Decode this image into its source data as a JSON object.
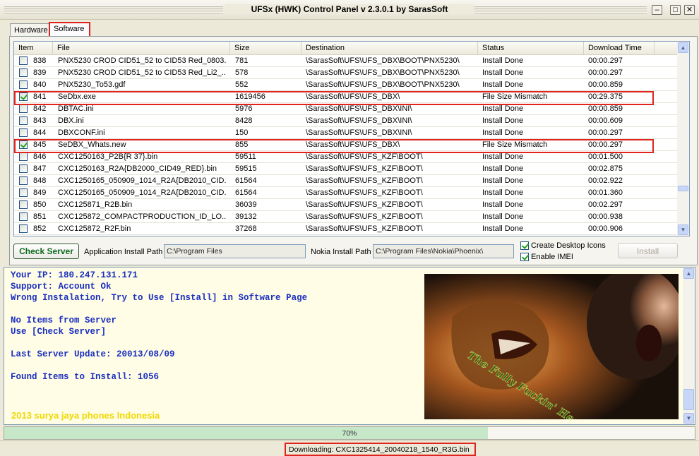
{
  "window": {
    "title": "UFSx (HWK) Control Panel v 2.3.0.1 by SarasSoft",
    "buttons": {
      "minimize": "–",
      "maximize": "□",
      "close": "✕"
    }
  },
  "tabs": [
    {
      "label": "Hardware",
      "active": false
    },
    {
      "label": "Software",
      "active": true
    }
  ],
  "table": {
    "columns": [
      "Item",
      "File",
      "Size",
      "Destination",
      "Status",
      "Download Time"
    ],
    "rows": [
      {
        "checked": false,
        "item": "838",
        "file": "PNX5230 CROD CID51_52 to CID53 Red_0803...",
        "size": "781",
        "dest": "\\SarasSoft\\UFS\\UFS_DBX\\BOOT\\PNX5230\\",
        "status": "Install Done",
        "time": "00:00.297",
        "highlight": false
      },
      {
        "checked": false,
        "item": "839",
        "file": "PNX5230 CROD CID51_52 to CID53 Red_Li2_...",
        "size": "578",
        "dest": "\\SarasSoft\\UFS\\UFS_DBX\\BOOT\\PNX5230\\",
        "status": "Install Done",
        "time": "00:00.297",
        "highlight": false
      },
      {
        "checked": false,
        "item": "840",
        "file": "PNX5230_To53.gdf",
        "size": "552",
        "dest": "\\SarasSoft\\UFS\\UFS_DBX\\BOOT\\PNX5230\\",
        "status": "Install Done",
        "time": "00:00.859",
        "highlight": false
      },
      {
        "checked": true,
        "item": "841",
        "file": "SeDbx.exe",
        "size": "1619456",
        "dest": "\\SarasSoft\\UFS\\UFS_DBX\\",
        "status": "File Size Mismatch",
        "time": "00:29.375",
        "highlight": true
      },
      {
        "checked": false,
        "item": "842",
        "file": "DBTAC.ini",
        "size": "5976",
        "dest": "\\SarasSoft\\UFS\\UFS_DBX\\INI\\",
        "status": "Install Done",
        "time": "00:00.859",
        "highlight": false
      },
      {
        "checked": false,
        "item": "843",
        "file": "DBX.ini",
        "size": "8428",
        "dest": "\\SarasSoft\\UFS\\UFS_DBX\\INI\\",
        "status": "Install Done",
        "time": "00:00.609",
        "highlight": false
      },
      {
        "checked": false,
        "item": "844",
        "file": "DBXCONF.ini",
        "size": "150",
        "dest": "\\SarasSoft\\UFS\\UFS_DBX\\INI\\",
        "status": "Install Done",
        "time": "00:00.297",
        "highlight": false
      },
      {
        "checked": true,
        "item": "845",
        "file": "SeDBX_Whats.new",
        "size": "855",
        "dest": "\\SarasSoft\\UFS\\UFS_DBX\\",
        "status": "File Size Mismatch",
        "time": "00:00.297",
        "highlight": true
      },
      {
        "checked": false,
        "item": "846",
        "file": "CXC1250163_P2B{R 37}.bin",
        "size": "59511",
        "dest": "\\SarasSoft\\UFS\\UFS_KZF\\BOOT\\",
        "status": "Install Done",
        "time": "00:01.500",
        "highlight": false
      },
      {
        "checked": false,
        "item": "847",
        "file": "CXC1250163_R2A{DB2000_CID49_RED}.bin",
        "size": "59515",
        "dest": "\\SarasSoft\\UFS\\UFS_KZF\\BOOT\\",
        "status": "Install Done",
        "time": "00:02.875",
        "highlight": false
      },
      {
        "checked": false,
        "item": "848",
        "file": "CXC1250165_050909_1014_R2A{DB2010_CID...",
        "size": "61564",
        "dest": "\\SarasSoft\\UFS\\UFS_KZF\\BOOT\\",
        "status": "Install Done",
        "time": "00:02.922",
        "highlight": false
      },
      {
        "checked": false,
        "item": "849",
        "file": "CXC1250165_050909_1014_R2A{DB2010_CID...",
        "size": "61564",
        "dest": "\\SarasSoft\\UFS\\UFS_KZF\\BOOT\\",
        "status": "Install Done",
        "time": "00:01.360",
        "highlight": false
      },
      {
        "checked": false,
        "item": "850",
        "file": "CXC125871_R2B.bin",
        "size": "36039",
        "dest": "\\SarasSoft\\UFS\\UFS_KZF\\BOOT\\",
        "status": "Install Done",
        "time": "00:02.297",
        "highlight": false
      },
      {
        "checked": false,
        "item": "851",
        "file": "CXC125872_COMPACTPRODUCTION_ID_LO...",
        "size": "39132",
        "dest": "\\SarasSoft\\UFS\\UFS_KZF\\BOOT\\",
        "status": "Install Done",
        "time": "00:00.938",
        "highlight": false
      },
      {
        "checked": false,
        "item": "852",
        "file": "CXC125872_R2F.bin",
        "size": "37268",
        "dest": "\\SarasSoft\\UFS\\UFS_KZF\\BOOT\\",
        "status": "Install Done",
        "time": "00:00.906",
        "highlight": false
      }
    ]
  },
  "controls": {
    "check_server": "Check Server",
    "app_path_label": "Application Install Path",
    "app_path_value": "C:\\Program Files",
    "nokia_path_label": "Nokia Install Path",
    "nokia_path_value": "C:\\Program Files\\Nokia\\Phoenix\\",
    "create_icons_label": "Create Desktop Icons",
    "create_icons_checked": true,
    "enable_imei_label": "Enable IMEI",
    "enable_imei_checked": true,
    "install": "Install"
  },
  "log": {
    "lines": [
      "Your IP: 180.247.131.171",
      "Support: Account Ok",
      "Wrong Instalation, Try to Use [Install] in Software Page",
      "",
      "No Items from Server",
      "Use [Check Server]",
      "",
      "Last Server Update: 20013/08/09",
      "",
      "Found Items to Install: 1056"
    ],
    "footer": "2013 surya jaya phones Indonesia",
    "poster_caption": "The Fully Fuckin' Headache Lion"
  },
  "progress": {
    "percent": 70,
    "label": "70%"
  },
  "status": {
    "text": "Downloading: CXC1325414_20040218_1540_R3G.bin"
  },
  "colors": {
    "highlight": "#e0241d",
    "log_text": "#1a2fbf",
    "footer_text": "#f0d800",
    "progress_fill": "#c7e7c9"
  }
}
